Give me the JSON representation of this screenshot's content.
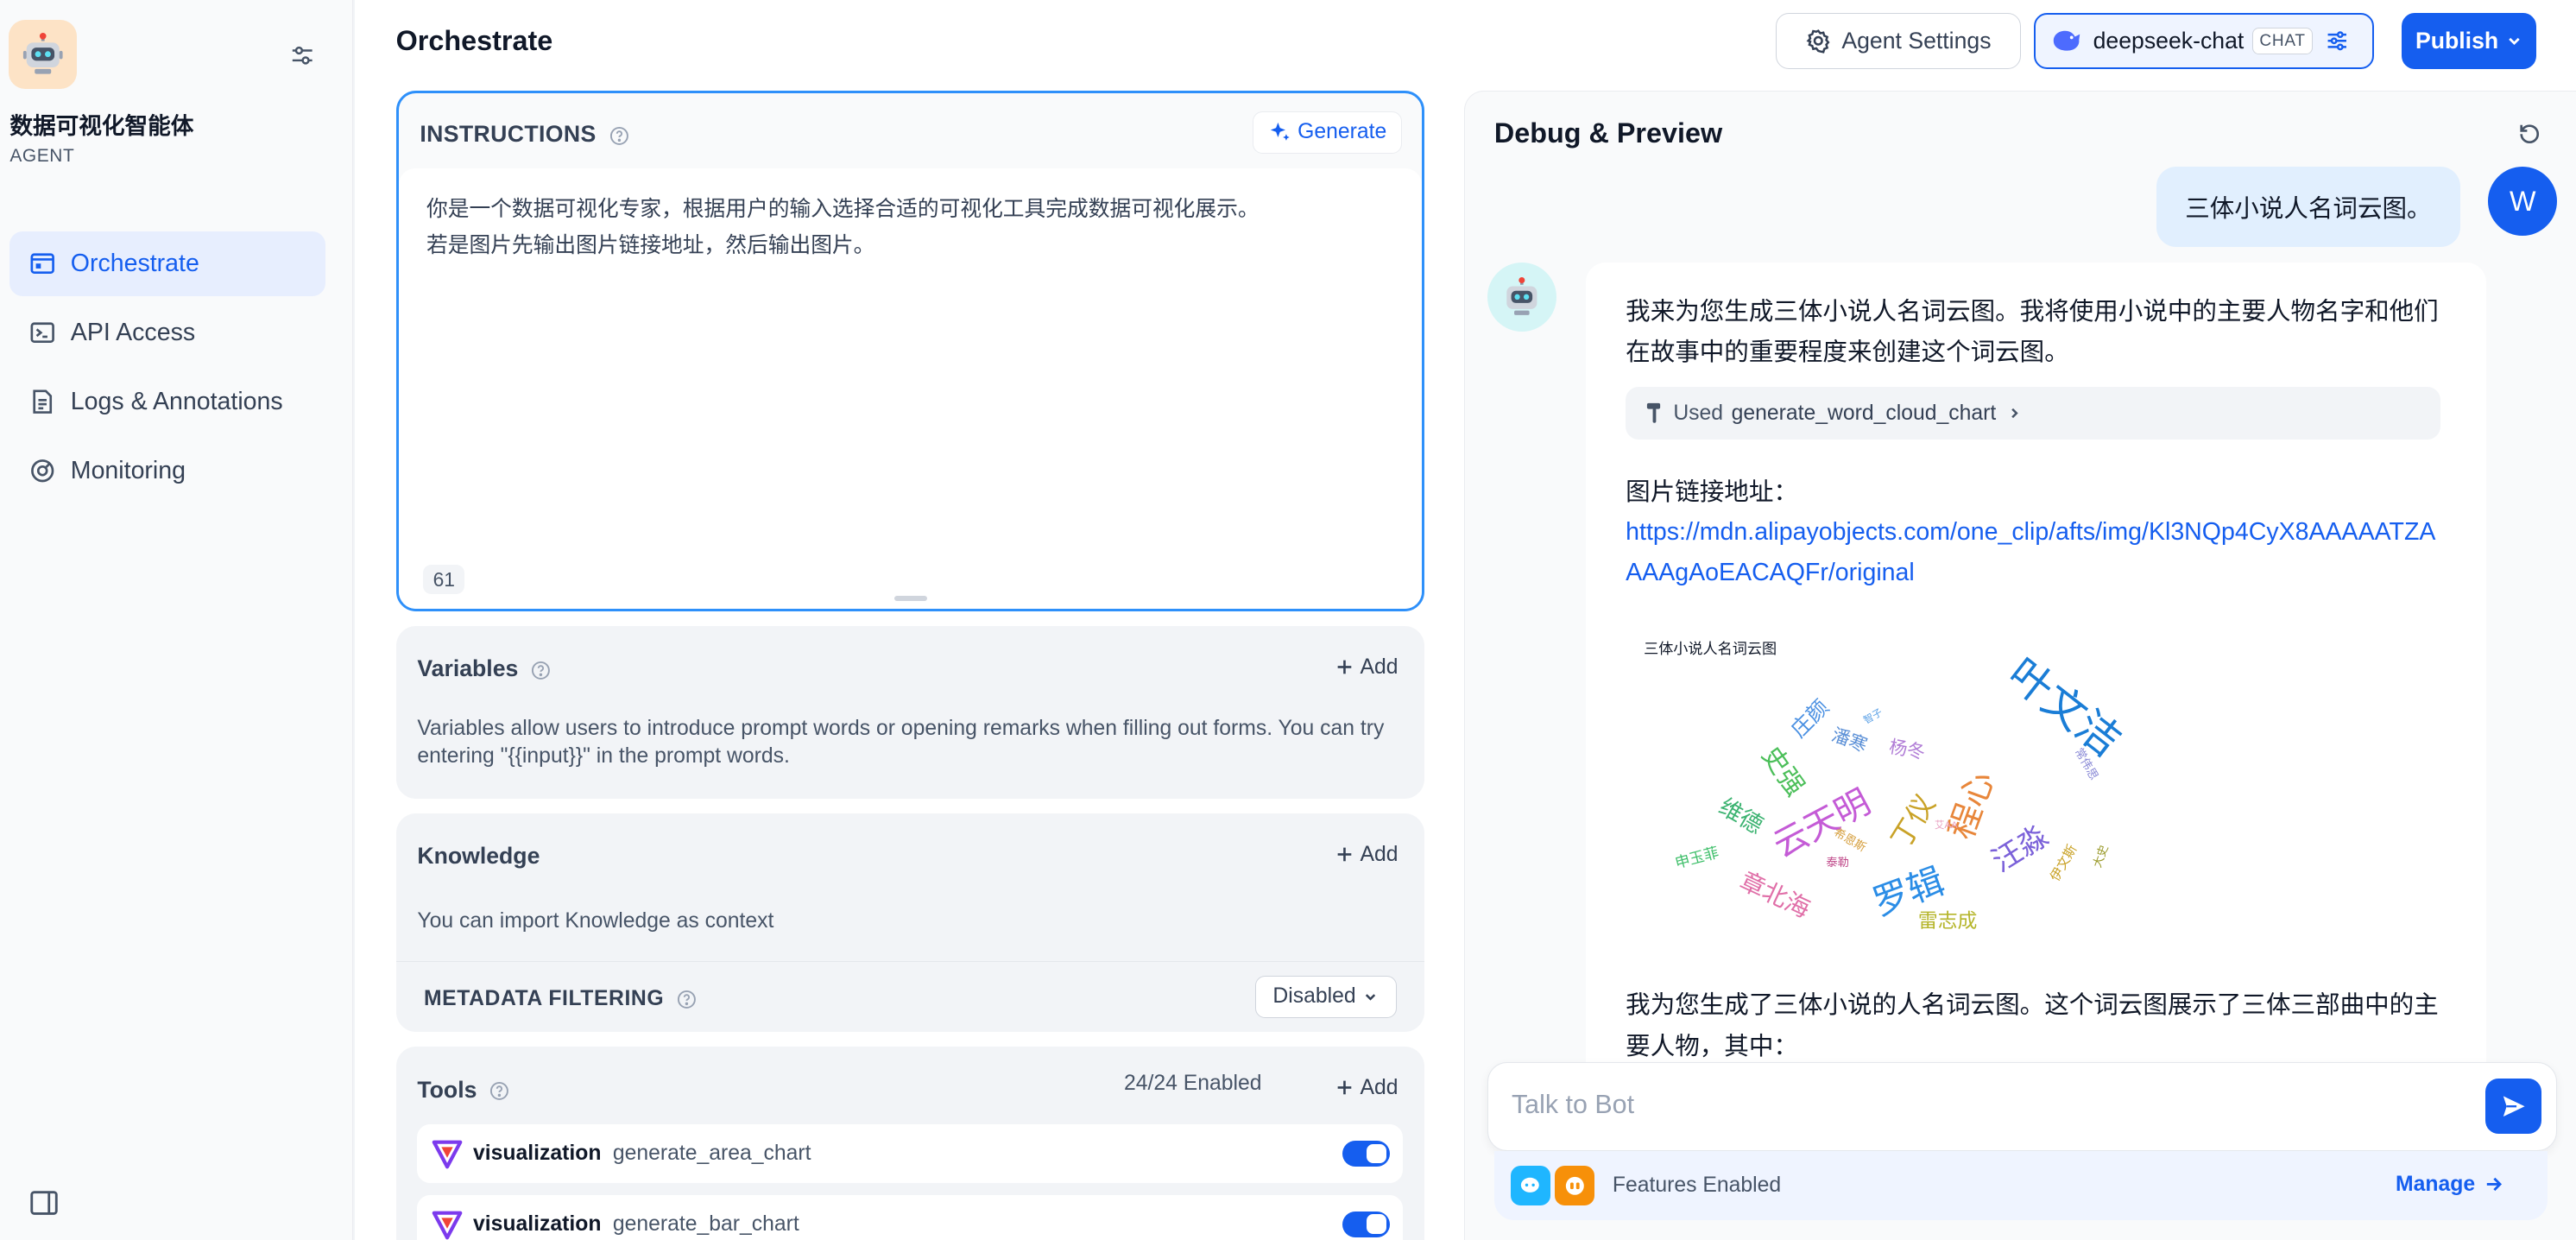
{
  "sidebar": {
    "app_name": "数据可视化智能体",
    "app_type": "AGENT",
    "nav": [
      {
        "label": "Orchestrate"
      },
      {
        "label": "API Access"
      },
      {
        "label": "Logs & Annotations"
      },
      {
        "label": "Monitoring"
      }
    ]
  },
  "header": {
    "title": "Orchestrate",
    "agent_settings_label": "Agent Settings",
    "model_name": "deepseek-chat",
    "model_badge": "CHAT",
    "publish_label": "Publish"
  },
  "instructions": {
    "title": "INSTRUCTIONS",
    "generate_label": "Generate",
    "text": "你是一个数据可视化专家，根据用户的输入选择合适的可视化工具完成数据可视化展示。\n若是图片先输出图片链接地址，然后输出图片。",
    "char_count": "61"
  },
  "variables": {
    "title": "Variables",
    "add_label": "Add",
    "description": "Variables allow users to introduce prompt words or opening remarks when filling out forms. You can try entering \"{{input}}\" in the prompt words."
  },
  "knowledge": {
    "title": "Knowledge",
    "add_label": "Add",
    "description": "You can import Knowledge as context",
    "metadata_title": "METADATA FILTERING",
    "metadata_value": "Disabled"
  },
  "tools": {
    "title": "Tools",
    "enabled_count": "24/24 Enabled",
    "add_label": "Add",
    "items": [
      {
        "provider": "visualization",
        "name": "generate_area_chart",
        "enabled": true
      },
      {
        "provider": "visualization",
        "name": "generate_bar_chart",
        "enabled": true
      }
    ]
  },
  "debug": {
    "title": "Debug & Preview",
    "user_avatar": "W",
    "user_message": "三体小说人名词云图。",
    "bot_intro": "我来为您生成三体小说人名词云图。我将使用小说中的主要人物名字和他们在故事中的重要程度来创建这个词云图。",
    "tool_used_prefix": "Used",
    "tool_used_name": "generate_word_cloud_chart",
    "image_link_label": "图片链接地址：",
    "image_link": "https://mdn.alipayobjects.com/one_clip/afts/img/Kl3NQp4CyX8AAAAATZAAAAgAoEACAQFr/original",
    "wordcloud_title": "三体小说人名词云图",
    "bot_followup": "我为您生成了三体小说的人名词云图。这个词云图展示了三体三部曲中的主要人物，其中：",
    "composer_placeholder": "Talk to Bot",
    "features_label": "Features Enabled",
    "manage_label": "Manage"
  },
  "wordcloud_words": [
    {
      "text": "叶文洁",
      "color": "#1a7dd6"
    },
    {
      "text": "程心",
      "color": "#e8863a"
    },
    {
      "text": "云天明",
      "color": "#c45bd6"
    },
    {
      "text": "罗辑",
      "color": "#2b8de6"
    },
    {
      "text": "汪淼",
      "color": "#7b61d9"
    },
    {
      "text": "章北海",
      "color": "#e06fa8"
    },
    {
      "text": "丁仪",
      "color": "#c9a227"
    },
    {
      "text": "史强",
      "color": "#4cbf5a"
    },
    {
      "text": "维德",
      "color": "#3cb371"
    },
    {
      "text": "雷志成",
      "color": "#b5b52a"
    },
    {
      "text": "庄颜",
      "color": "#4a90e2"
    },
    {
      "text": "杨冬",
      "color": "#b07cd6"
    },
    {
      "text": "潘寒",
      "color": "#5a8fd6"
    },
    {
      "text": "申玉菲",
      "color": "#3fbf6a"
    },
    {
      "text": "伊文斯",
      "color": "#c9a227"
    },
    {
      "text": "常伟思",
      "color": "#8a8ad6"
    },
    {
      "text": "希恩斯",
      "color": "#d6a040"
    },
    {
      "text": "泰勒",
      "color": "#c04a8a"
    },
    {
      "text": "智子",
      "color": "#5aa0e6"
    },
    {
      "text": "艾AA",
      "color": "#e8a0c0"
    },
    {
      "text": "大史",
      "color": "#9a9a2a"
    }
  ]
}
